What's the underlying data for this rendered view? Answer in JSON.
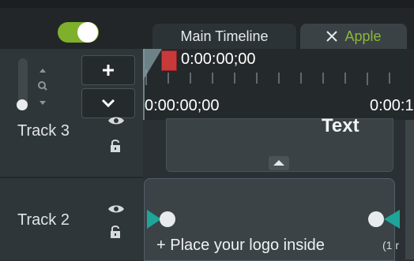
{
  "tabs": [
    {
      "label": "Main Timeline"
    },
    {
      "label": "Apple",
      "accent": "#8db63a"
    }
  ],
  "toggle": {
    "state": "on",
    "accent": "#7fb02b"
  },
  "toolbar": {
    "add_label": "+",
    "expand_label": "⌄"
  },
  "timeline": {
    "current_time": "0:00:00;00",
    "ruler_start": "0:00:00;00",
    "ruler_next": "0:00:1"
  },
  "tracks": [
    {
      "label": "Track 3",
      "clip_label": "Text"
    },
    {
      "label": "Track 2",
      "clip_label": "+ Place your logo inside",
      "clip_trailing": "(1 r"
    }
  ],
  "icons": {
    "close": "x-icon",
    "zoom": "zoom-icon",
    "eye": "eye-icon",
    "lock": "lock-icon",
    "plus": "plus-icon",
    "chevron": "chevron-down-icon"
  }
}
